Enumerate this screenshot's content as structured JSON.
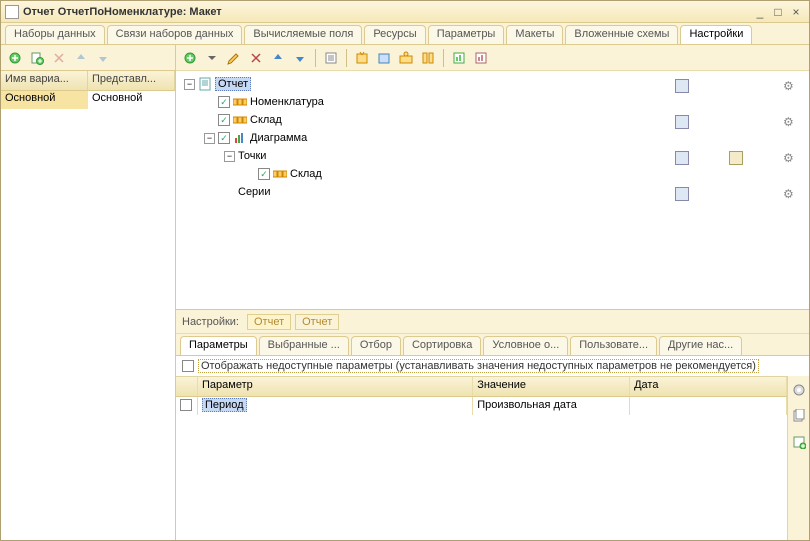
{
  "window": {
    "title": "Отчет ОтчетПоНоменклатуре: Макет"
  },
  "top_tabs": [
    "Наборы данных",
    "Связи наборов данных",
    "Вычисляемые поля",
    "Ресурсы",
    "Параметры",
    "Макеты",
    "Вложенные схемы",
    "Настройки"
  ],
  "top_tabs_active": 7,
  "left": {
    "headers": [
      "Имя вариа...",
      "Представл..."
    ],
    "rows": [
      {
        "name": "Основной",
        "repr": "Основной"
      }
    ]
  },
  "tree": {
    "root": "Отчет",
    "items": [
      {
        "depth": 1,
        "check": true,
        "icon": "group",
        "label": "Номенклатура",
        "icons_r": [
          "list",
          "",
          "gear"
        ]
      },
      {
        "depth": 1,
        "check": true,
        "icon": "group",
        "label": "Склад",
        "icons_r": [
          "list",
          "chart",
          "gear"
        ]
      },
      {
        "depth": 1,
        "check": true,
        "icon": "diagram",
        "label": "Диаграмма",
        "expander": "-",
        "icons_r": [
          "list",
          "",
          "gear"
        ]
      },
      {
        "depth": 2,
        "label": "Точки",
        "expander": "-"
      },
      {
        "depth": 3,
        "check": true,
        "icon": "group",
        "label": "Склад"
      },
      {
        "depth": 2,
        "label": "Серии"
      }
    ],
    "root_icons": [
      "list",
      "",
      "gear"
    ]
  },
  "settings_strip": {
    "label": "Настройки:",
    "crumbs": [
      "Отчет",
      "Отчет"
    ]
  },
  "inner_tabs": [
    "Параметры",
    "Выбранные ...",
    "Отбор",
    "Сортировка",
    "Условное о...",
    "Пользовате...",
    "Другие нас..."
  ],
  "inner_tabs_active": 0,
  "params": {
    "checkbox_label": "Отображать недоступные параметры (устанавливать значения недоступных параметров не рекомендуется)",
    "headers": [
      "",
      "Параметр",
      "Значение",
      "Дата"
    ],
    "rows": [
      {
        "checked": false,
        "param": "Период",
        "value": "Произвольная дата",
        "date": ""
      }
    ]
  }
}
